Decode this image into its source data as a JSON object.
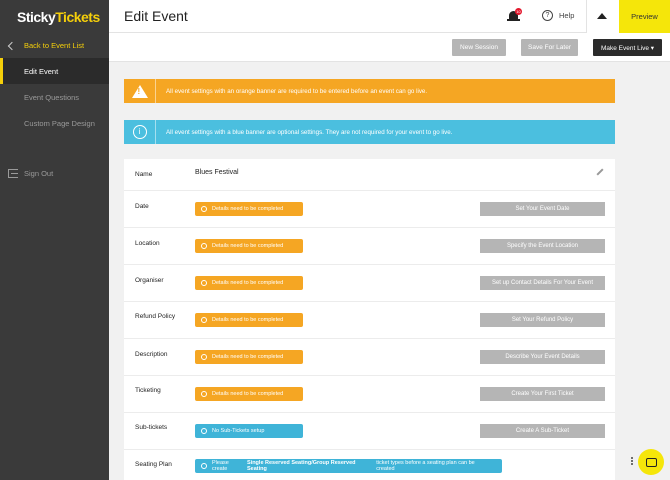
{
  "app": {
    "logo_part1": "Sticky",
    "logo_part2": "Tickets"
  },
  "sidebar": {
    "back_label": "Back to Event List",
    "items": [
      {
        "label": "Edit Event",
        "active": true
      },
      {
        "label": "Event Questions",
        "active": false
      },
      {
        "label": "Custom Page Design",
        "active": false
      }
    ],
    "sign_out": "Sign Out"
  },
  "header": {
    "title": "Edit Event",
    "notification_count": "10",
    "help_label": "Help",
    "preview_label": "Preview"
  },
  "toolbar": {
    "new_session": "New Session",
    "save_later": "Save For Later",
    "make_live": "Make Event Live ▾"
  },
  "banners": {
    "orange": "All event settings with an orange banner are required to be entered before an event can go live.",
    "blue": "All event settings with a blue banner are optional settings. They are not required for your event to go live."
  },
  "settings": {
    "name": {
      "label": "Name",
      "value": "Blues Festival"
    },
    "rows": [
      {
        "label": "Date",
        "status": "Details need to be completed",
        "action": "Set Your Event Date"
      },
      {
        "label": "Location",
        "status": "Details need to be completed",
        "action": "Specify the Event Location"
      },
      {
        "label": "Organiser",
        "status": "Details need to be completed",
        "action": "Set up Contact Details For Your Event"
      },
      {
        "label": "Refund Policy",
        "status": "Details need to be completed",
        "action": "Set Your Refund Policy"
      },
      {
        "label": "Description",
        "status": "Details need to be completed",
        "action": "Describe Your Event Details"
      },
      {
        "label": "Ticketing",
        "status": "Details need to be completed",
        "action": "Create Your First Ticket"
      }
    ],
    "subtickets": {
      "label": "Sub-tickets",
      "status": "No Sub-Tickets setup",
      "action": "Create A Sub-Ticket"
    },
    "seating": {
      "label": "Seating Plan",
      "status_pre": "Please create ",
      "status_bold": "Single Reserved Seating/Group Reserved Seating",
      "status_post": " ticket types before a seating plan can be created"
    }
  },
  "colors": {
    "accent": "#f5cf0a",
    "required": "#f5a623",
    "optional": "#4bbfdf",
    "sidebar": "#3a3a3a"
  }
}
